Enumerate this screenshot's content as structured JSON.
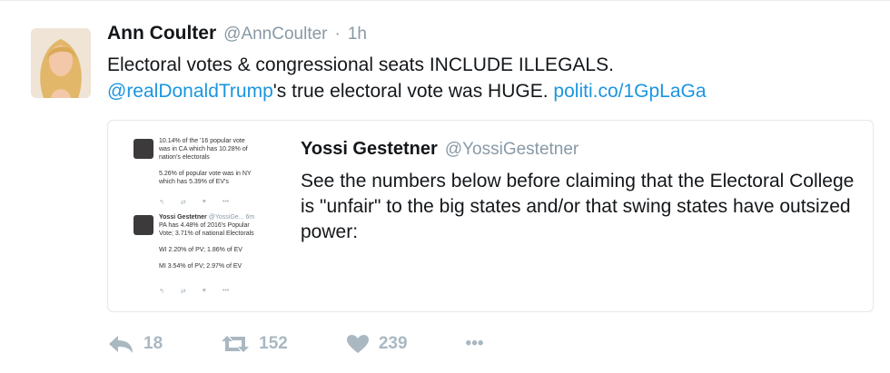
{
  "tweet": {
    "author_name": "Ann Coulter",
    "author_handle": "@AnnCoulter",
    "separator": "·",
    "time": "1h",
    "text_line1": "Electoral votes & congressional seats INCLUDE ILLEGALS.",
    "mention": "@realDonaldTrump",
    "text_line2_rest": "'s true electoral vote was HUGE.",
    "link": "politi.co/1GpLaGa"
  },
  "quoted": {
    "author_name": "Yossi Gestetner",
    "author_handle": "@YossiGestetner",
    "text": "See the numbers below before claiming that the Electoral College is \"unfair\" to the big states and/or that swing states have outsized power:",
    "media": {
      "tweet1_lines": [
        "10.14% of the '16 popular vote",
        "was in CA which has 10.28% of",
        "nation's electorals",
        "",
        "5.26% of popular vote was in NY",
        "which has 5.39% of EV's"
      ],
      "tweet2_name": "Yossi Gestetner",
      "tweet2_handle": "@YossiGe...",
      "tweet2_time": "6m",
      "tweet2_lines": [
        "PA has 4.48% of 2016's Popular",
        "Vote; 3.71% of national Electorals",
        "",
        "WI 2.20% of PV; 1.86% of EV",
        "",
        "MI 3.54% of PV; 2.97% of EV"
      ],
      "mini_action_icons": [
        "reply-icon",
        "retweet-icon",
        "like-icon",
        "more-icon"
      ]
    }
  },
  "actions": {
    "reply_count": "18",
    "retweet_count": "152",
    "like_count": "239",
    "more_label": "•••"
  },
  "colors": {
    "link": "#1b95e0",
    "muted": "#8899a6",
    "icon": "#aab8c2",
    "text": "#14171a"
  }
}
